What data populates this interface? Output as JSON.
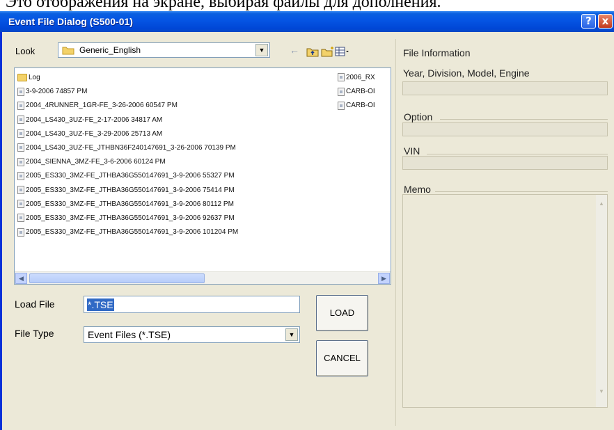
{
  "caption": "Это отображения на экране, выбирая файлы для дополнения.",
  "window": {
    "title": "Event File Dialog (S500-01)",
    "help_glyph": "?",
    "close_glyph": "x"
  },
  "look": {
    "label": "Look",
    "value": "Generic_English",
    "dropdown_glyph": "▼",
    "icons": [
      "back-arrow-icon",
      "up-folder-icon",
      "new-folder-icon",
      "views-menu-icon"
    ]
  },
  "file_list": {
    "column1": [
      {
        "name": "Log",
        "type": "folder"
      },
      {
        "name": "3-9-2006 74857 PM",
        "type": "file"
      },
      {
        "name": "2004_4RUNNER_1GR-FE_3-26-2006 60547 PM",
        "type": "file"
      },
      {
        "name": "2004_LS430_3UZ-FE_2-17-2006 34817 AM",
        "type": "file"
      },
      {
        "name": "2004_LS430_3UZ-FE_3-29-2006 25713 AM",
        "type": "file"
      },
      {
        "name": "2004_LS430_3UZ-FE_JTHBN36F240147691_3-26-2006 70139 PM",
        "type": "file"
      },
      {
        "name": "2004_SIENNA_3MZ-FE_3-6-2006 60124 PM",
        "type": "file"
      },
      {
        "name": "2005_ES330_3MZ-FE_JTHBA36G550147691_3-9-2006 55327 PM",
        "type": "file"
      },
      {
        "name": "2005_ES330_3MZ-FE_JTHBA36G550147691_3-9-2006 75414 PM",
        "type": "file"
      },
      {
        "name": "2005_ES330_3MZ-FE_JTHBA36G550147691_3-9-2006 80112 PM",
        "type": "file"
      },
      {
        "name": "2005_ES330_3MZ-FE_JTHBA36G550147691_3-9-2006 92637 PM",
        "type": "file"
      },
      {
        "name": "2005_ES330_3MZ-FE_JTHBA36G550147691_3-9-2006 101204 PM",
        "type": "file"
      }
    ],
    "column2": [
      {
        "name": "2006_RX",
        "type": "file"
      },
      {
        "name": "CARB-OI",
        "type": "file"
      },
      {
        "name": "CARB-OI",
        "type": "file"
      }
    ],
    "scroll_left_glyph": "◀",
    "scroll_right_glyph": "▶"
  },
  "load_file": {
    "label": "Load File",
    "value": "*.TSE"
  },
  "file_type": {
    "label": "File Type",
    "value": "Event Files (*.TSE)",
    "dropdown_glyph": "▼"
  },
  "buttons": {
    "load": "LOAD",
    "cancel": "CANCEL"
  },
  "info": {
    "title": "File Information",
    "year_division_model_engine": "Year, Division, Model, Engine",
    "option_label": "Option",
    "vin_label": "VIN",
    "memo_label": "Memo",
    "memo_up_glyph": "▲",
    "memo_down_glyph": "▼"
  },
  "colors": {
    "titlebar": "#0554e3",
    "window_bg": "#ece9d8",
    "selection": "#316ac5",
    "close_button": "#c2391e"
  }
}
